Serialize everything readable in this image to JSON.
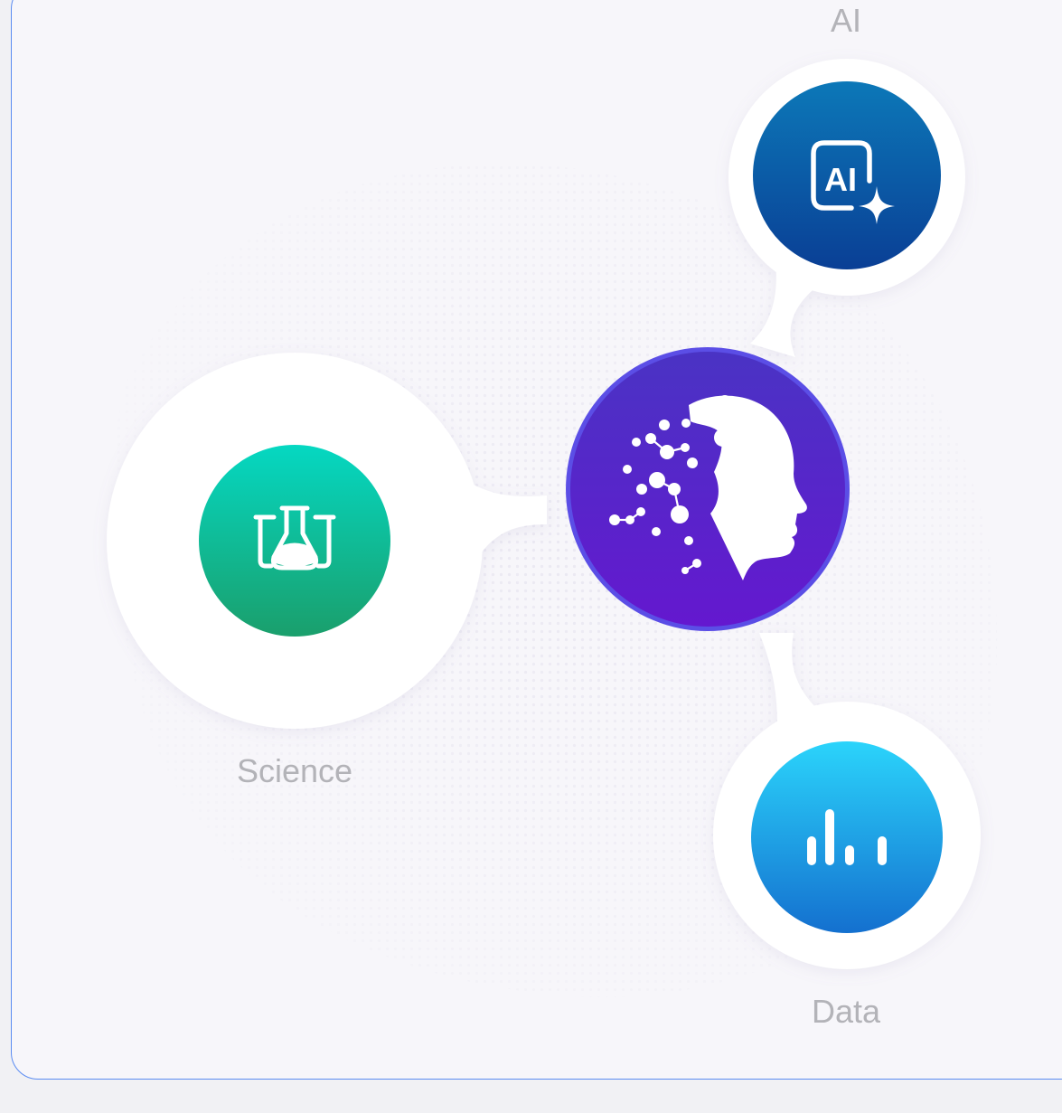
{
  "nodes": {
    "ai": {
      "label": "AI",
      "icon": "ai-sparkle-icon",
      "colors": [
        "#0c78b8",
        "#0a3f95"
      ]
    },
    "science": {
      "label": "Science",
      "icon": "lab-flasks-icon",
      "colors": [
        "#05d8c2",
        "#1a9f6c"
      ]
    },
    "hub": {
      "icon": "ai-head-icon",
      "colors": [
        "#5a3fd8",
        "#5b16c9"
      ]
    },
    "data": {
      "label": "Data",
      "icon": "bar-chart-icon",
      "colors": [
        "#2bd4fb",
        "#1470cf"
      ]
    }
  },
  "colors": {
    "card_border": "#5b8cf2",
    "card_background": "#f7f6fa",
    "label_text": "#b3b3b8",
    "connector": "#ffffff"
  }
}
